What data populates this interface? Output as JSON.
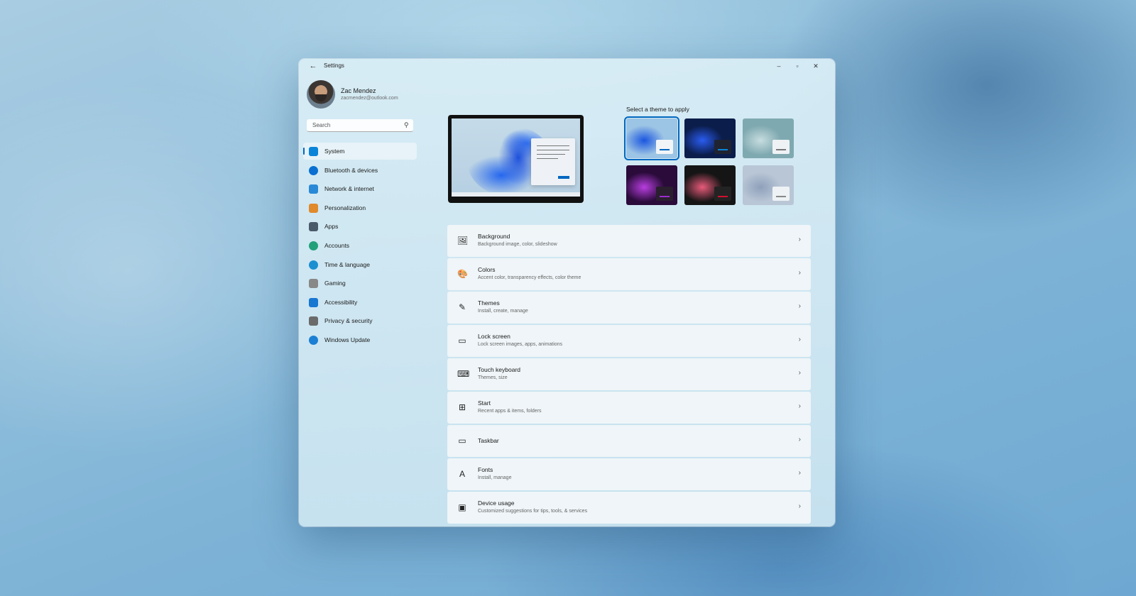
{
  "window": {
    "title": "Settings"
  },
  "profile": {
    "name": "Zac Mendez",
    "email": "zacmendez@outlook.com"
  },
  "search": {
    "placeholder": "Search"
  },
  "sidebar": {
    "items": [
      {
        "label": "System",
        "icon": "system-icon",
        "color": "#0a84d8",
        "active": true
      },
      {
        "label": "Bluetooth & devices",
        "icon": "bluetooth-icon",
        "color": "#0a6fd1"
      },
      {
        "label": "Network & internet",
        "icon": "wifi-icon",
        "color": "#2a89d6"
      },
      {
        "label": "Personalization",
        "icon": "paintbrush-icon",
        "color": "#e08a2c"
      },
      {
        "label": "Apps",
        "icon": "apps-icon",
        "color": "#4a5a6a"
      },
      {
        "label": "Accounts",
        "icon": "person-icon",
        "color": "#22a07a"
      },
      {
        "label": "Time & language",
        "icon": "globe-clock-icon",
        "color": "#1c8fd0"
      },
      {
        "label": "Gaming",
        "icon": "controller-icon",
        "color": "#888888"
      },
      {
        "label": "Accessibility",
        "icon": "accessibility-icon",
        "color": "#1877d1"
      },
      {
        "label": "Privacy & security",
        "icon": "shield-icon",
        "color": "#6b6b6b"
      },
      {
        "label": "Windows Update",
        "icon": "update-icon",
        "color": "#1b7fd4"
      }
    ]
  },
  "themes": {
    "title": "Select a theme to apply",
    "selected_index": 0,
    "items": [
      {
        "name": "windows-light-bloom-theme",
        "bg": "#9cc4e4",
        "fg": "#1a56e0",
        "mini": "#f2f5f8",
        "accent": "#0067c0"
      },
      {
        "name": "windows-dark-bloom-theme",
        "bg": "#0b1d4a",
        "fg": "#2a5cf0",
        "mini": "#1f2430",
        "accent": "#0a84d8"
      },
      {
        "name": "glow-lake-theme",
        "bg": "#7fa9b0",
        "fg": "#c7dde0",
        "mini": "#eef2f5",
        "accent": "#777777"
      },
      {
        "name": "captured-motion-theme",
        "bg": "#2a0b3a",
        "fg": "#b83ee0",
        "mini": "#2a1f2f",
        "accent": "#9b2cd0"
      },
      {
        "name": "flow-theme",
        "bg": "#151515",
        "fg": "#e85a7a",
        "mini": "#232323",
        "accent": "#d01030"
      },
      {
        "name": "sunrise-bloom-theme",
        "bg": "#b9c6d6",
        "fg": "#8ea0ba",
        "mini": "#eef2f5",
        "accent": "#888888"
      }
    ]
  },
  "settings": [
    {
      "title": "Background",
      "subtitle": "Background image, color, slideshow",
      "icon": "image-icon",
      "glyph": "🖼"
    },
    {
      "title": "Colors",
      "subtitle": "Accent color, transparency effects, color theme",
      "icon": "palette-icon",
      "glyph": "🎨"
    },
    {
      "title": "Themes",
      "subtitle": "Install, create, manage",
      "icon": "pen-icon",
      "glyph": "✎"
    },
    {
      "title": "Lock screen",
      "subtitle": "Lock screen images, apps, animations",
      "icon": "lock-screen-icon",
      "glyph": "▭"
    },
    {
      "title": "Touch keyboard",
      "subtitle": "Themes, size",
      "icon": "keyboard-icon",
      "glyph": "⌨"
    },
    {
      "title": "Start",
      "subtitle": "Recent apps & items, folders",
      "icon": "start-icon",
      "glyph": "⊞"
    },
    {
      "title": "Taskbar",
      "subtitle": "",
      "icon": "taskbar-icon",
      "glyph": "▭"
    },
    {
      "title": "Fonts",
      "subtitle": "Install, manage",
      "icon": "fonts-icon",
      "glyph": "A"
    },
    {
      "title": "Device usage",
      "subtitle": "Customized suggestions for tips, tools, & services",
      "icon": "device-usage-icon",
      "glyph": "▣"
    }
  ]
}
